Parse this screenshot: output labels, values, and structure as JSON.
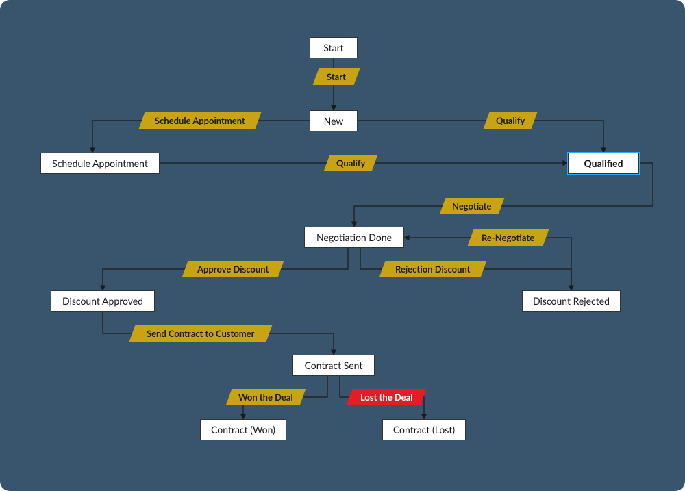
{
  "colors": {
    "canvas_bg": "#38556d",
    "state_bg": "#ffffff",
    "action_bg": "#c8a415",
    "action_lost_bg": "#e51c23",
    "action_lost_fg": "#ffffff",
    "text": "#1a1a1a",
    "arrow": "#1a1a1a"
  },
  "states": {
    "start": {
      "label": "Start"
    },
    "new": {
      "label": "New"
    },
    "schedule_appointment": {
      "label": "Schedule Appointment"
    },
    "qualified": {
      "label": "Qualified"
    },
    "negotiation_done": {
      "label": "Negotiation Done"
    },
    "discount_approved": {
      "label": "Discount Approved"
    },
    "discount_rejected": {
      "label": "Discount Rejected"
    },
    "contract_sent": {
      "label": "Contract Sent"
    },
    "contract_won": {
      "label": "Contract (Won)"
    },
    "contract_lost": {
      "label": "Contract (Lost)"
    }
  },
  "actions": {
    "start": {
      "label": "Start"
    },
    "schedule_appt": {
      "label": "Schedule Appointment"
    },
    "qualify_from_new": {
      "label": "Qualify"
    },
    "qualify_from_sched": {
      "label": "Qualify"
    },
    "negotiate": {
      "label": "Negotiate"
    },
    "re_negotiate": {
      "label": "Re-Negotiate"
    },
    "approve_discount": {
      "label": "Approve Discount"
    },
    "rejection_discount": {
      "label": "Rejection Discount"
    },
    "send_contract": {
      "label": "Send Contract to Customer"
    },
    "won_deal": {
      "label": "Won the Deal"
    },
    "lost_deal": {
      "label": "Lost the Deal"
    }
  },
  "edges": [
    {
      "from": "start",
      "action": "start",
      "to": "new"
    },
    {
      "from": "new",
      "action": "schedule_appt",
      "to": "schedule_appointment"
    },
    {
      "from": "new",
      "action": "qualify_from_new",
      "to": "qualified"
    },
    {
      "from": "schedule_appointment",
      "action": "qualify_from_sched",
      "to": "qualified"
    },
    {
      "from": "qualified",
      "action": "negotiate",
      "to": "negotiation_done"
    },
    {
      "from": "negotiation_done",
      "action": "approve_discount",
      "to": "discount_approved"
    },
    {
      "from": "negotiation_done",
      "action": "rejection_discount",
      "to": "discount_rejected"
    },
    {
      "from": "discount_rejected",
      "action": "re_negotiate",
      "to": "negotiation_done"
    },
    {
      "from": "discount_approved",
      "action": "send_contract",
      "to": "contract_sent"
    },
    {
      "from": "contract_sent",
      "action": "won_deal",
      "to": "contract_won"
    },
    {
      "from": "contract_sent",
      "action": "lost_deal",
      "to": "contract_lost"
    }
  ]
}
